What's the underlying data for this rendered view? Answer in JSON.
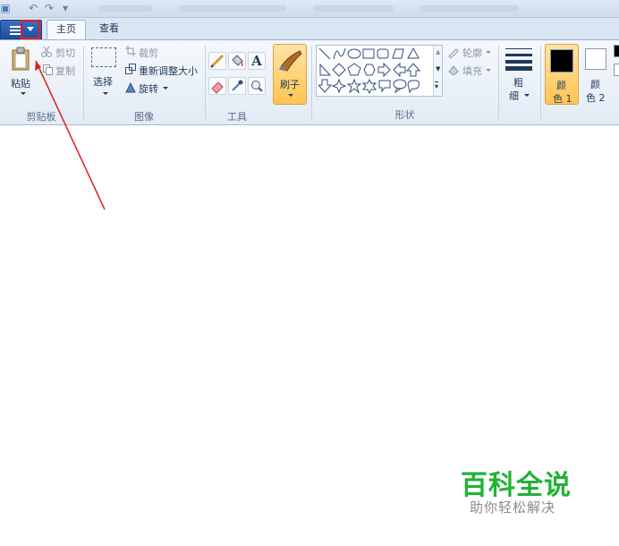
{
  "quick_access": {
    "icons": [
      "paint-app-icon",
      "undo-icon",
      "redo-icon",
      "customize-dropdown-icon"
    ]
  },
  "tabs": [
    {
      "label": "主页",
      "active": true
    },
    {
      "label": "查看",
      "active": false
    }
  ],
  "clipboard": {
    "paste_label": "粘贴",
    "cut_label": "剪切",
    "copy_label": "复制",
    "group_label": "剪贴板"
  },
  "image": {
    "select_label": "选择",
    "crop_label": "裁剪",
    "resize_label": "重新调整大小",
    "rotate_label": "旋转",
    "group_label": "图像"
  },
  "tools": {
    "group_label": "工具",
    "items": [
      "pencil-icon",
      "fill-bucket-icon",
      "text-icon",
      "eraser-icon",
      "color-picker-icon",
      "magnifier-icon"
    ]
  },
  "brush": {
    "label": "刷子"
  },
  "shapes": {
    "outline_label": "轮廓",
    "fill_label": "填充",
    "group_label": "形状"
  },
  "size": {
    "label_line1": "粗",
    "label_line2": "细"
  },
  "colors": {
    "color1_line1": "颜",
    "color1_line2": "色 1",
    "color2_line1": "颜",
    "color2_line2": "色 2",
    "color1": "#000000",
    "color2": "#ffffff"
  },
  "annotation": {
    "highlight_color": "#e02020"
  },
  "watermark": {
    "title": "百科全说",
    "subtitle": "助你轻松解决",
    "color": "#21b236"
  }
}
